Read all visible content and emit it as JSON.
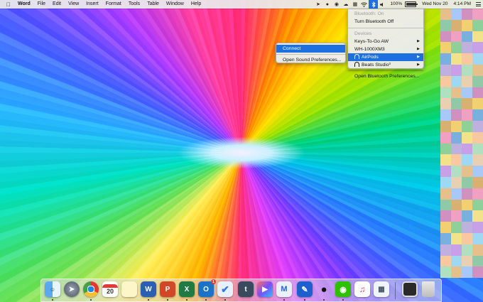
{
  "menu_bar": {
    "app_name": "Word",
    "menus": [
      "File",
      "Edit",
      "View",
      "Insert",
      "Format",
      "Tools",
      "Table",
      "Window",
      "Help"
    ],
    "battery_percent": "100%",
    "battery_level": 1.0,
    "datetime": "Wed Nov 20",
    "time": "4:14 PM",
    "status_icons": [
      "send-icon",
      "bell-icon",
      "chat-icon",
      "cloud-icon",
      "calendar-icon",
      "wifi-icon",
      "bluetooth-icon",
      "volume-icon"
    ]
  },
  "bluetooth_menu": {
    "status": "Bluetooth: On",
    "toggle": "Turn Bluetooth Off",
    "devices_header": "Devices",
    "devices": [
      "Keys-To-Go AW",
      "WH-1000XM3",
      "AirPods",
      "Beats Studio³"
    ],
    "open_prefs": "Open Bluetooth Preferences..."
  },
  "airpods_submenu": {
    "connect": "Connect",
    "open_sound_prefs": "Open Sound Preferences..."
  },
  "dock": {
    "calendar_day": "20",
    "apps": [
      "Finder",
      "Launchpad",
      "Google Chrome",
      "Calendar",
      "Notes",
      "Microsoft Word",
      "Microsoft PowerPoint",
      "Microsoft Excel",
      "Microsoft Outlook",
      "Things",
      "Tumblr",
      "Final Cut Pro",
      "Stock",
      "Pages",
      "QQ",
      "WeChat",
      "Music",
      "Preview",
      "Screen",
      "Trash"
    ],
    "outlook_badge": "1"
  },
  "colors": {
    "highlight": "#1e6fe0",
    "menu_bg": "#ececec"
  }
}
